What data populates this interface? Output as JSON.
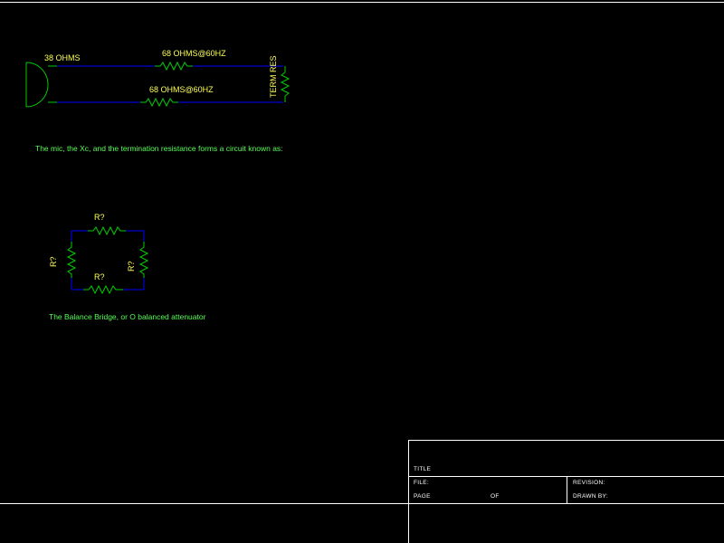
{
  "colors": {
    "background": "#000000",
    "wire": "#0000ff",
    "component": "#00cc00",
    "label": "#ffff55",
    "note": "#55ff55",
    "border": "#ffffff"
  },
  "circuit1": {
    "mic_label": "38 OHMS",
    "top_resistor_label": "68 OHMS@60HZ",
    "bottom_resistor_label": "68 OHMS@60HZ",
    "termination_label": "TERM RES"
  },
  "caption1": "The mic, the Xc, and the termination resistance forms a circuit known as:",
  "circuit2": {
    "top_label": "R?",
    "bottom_label": "R?",
    "left_label": "R?",
    "right_label": "R?"
  },
  "caption2": "The Balance Bridge, or O balanced attenuator",
  "title_block": {
    "title": "TITLE",
    "file": "FILE:",
    "page": "PAGE",
    "of": "OF",
    "revision": "REVISION:",
    "drawn_by": "DRAWN BY:"
  }
}
